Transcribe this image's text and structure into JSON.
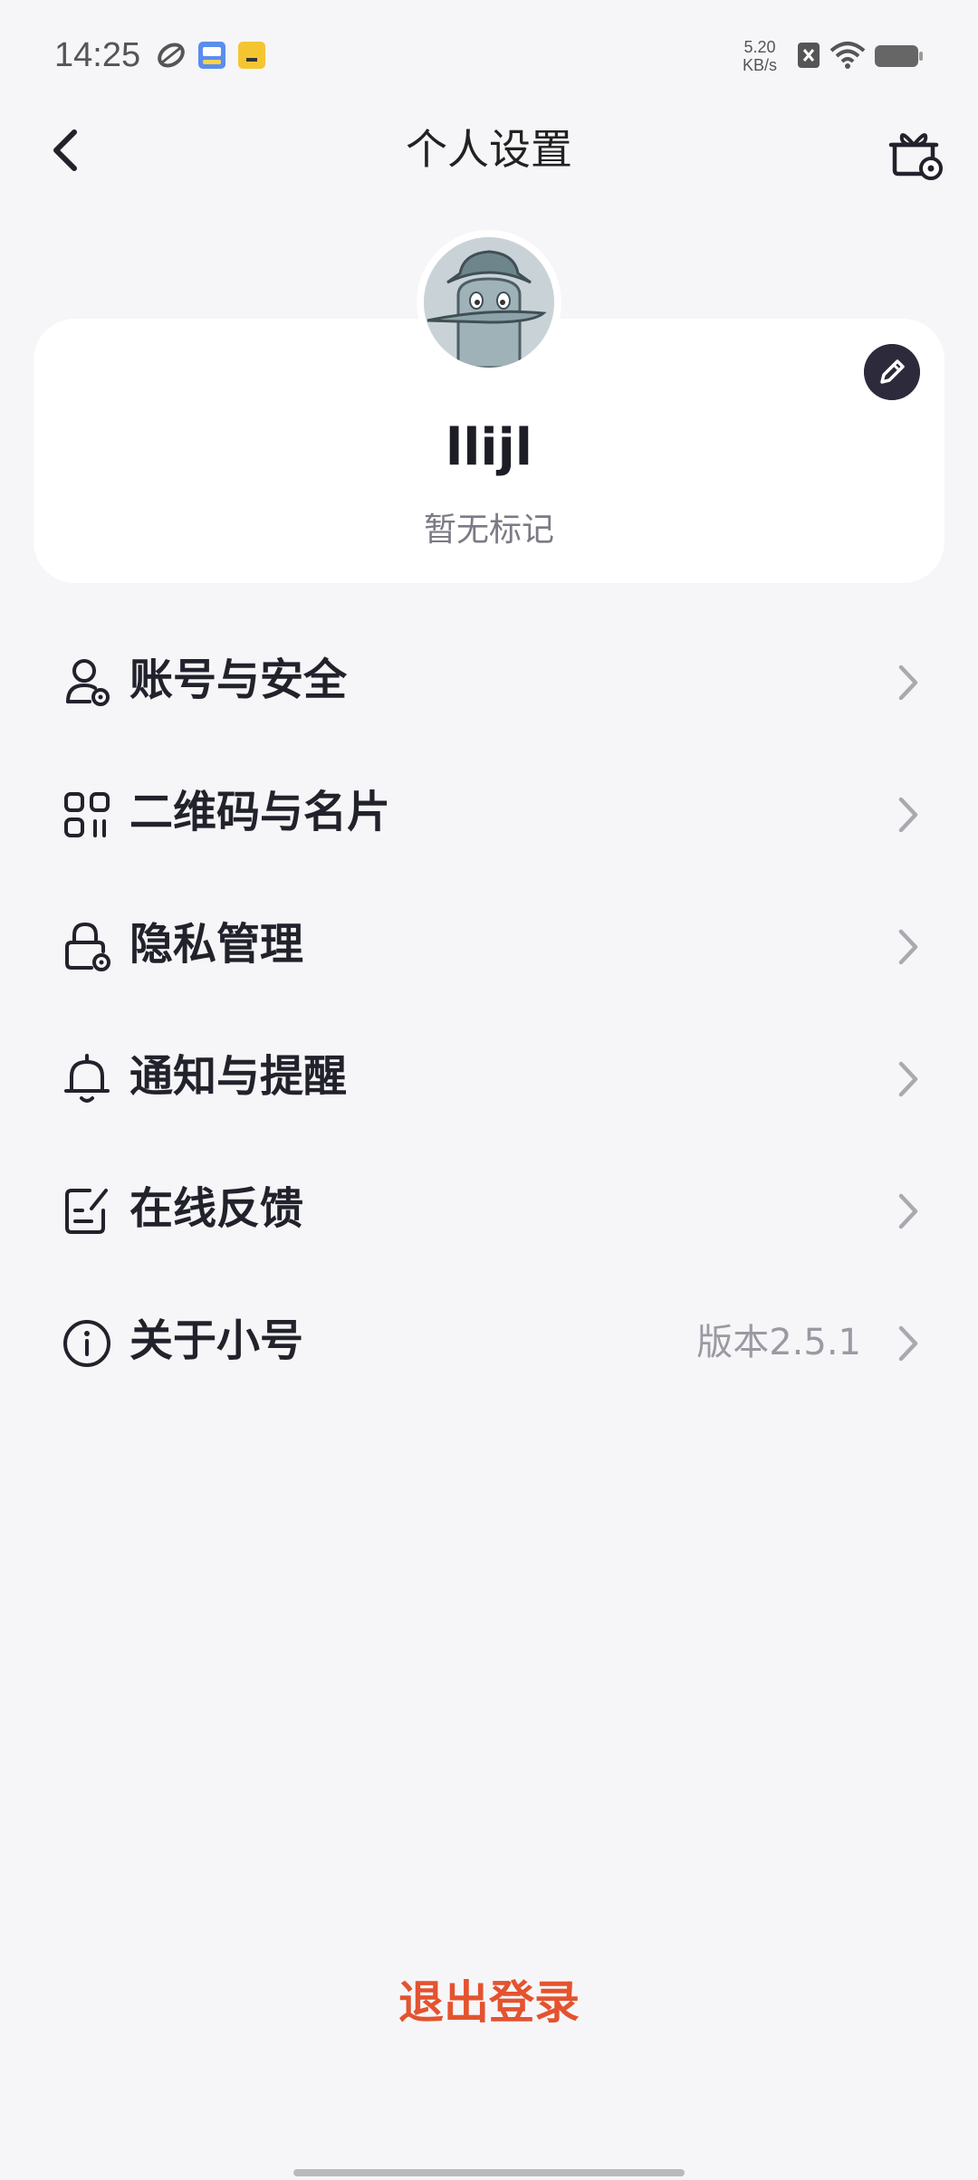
{
  "status_bar": {
    "time": "14:25",
    "net_speed": "5.20",
    "net_unit": "KB/s"
  },
  "nav": {
    "title": "个人设置"
  },
  "profile": {
    "username": "llijl",
    "remark": "暂无标记"
  },
  "menu": [
    {
      "label": "账号与安全",
      "icon": "user-settings-icon"
    },
    {
      "label": "二维码与名片",
      "icon": "qr-code-icon"
    },
    {
      "label": "隐私管理",
      "icon": "lock-settings-icon"
    },
    {
      "label": "通知与提醒",
      "icon": "bell-icon"
    },
    {
      "label": "在线反馈",
      "icon": "feedback-icon"
    },
    {
      "label": "关于小号",
      "icon": "info-icon",
      "value": "版本2.5.1"
    }
  ],
  "logout_label": "退出登录",
  "colors": {
    "background": "#f6f6f8",
    "accent": "#e4532f",
    "text": "#22222c"
  }
}
